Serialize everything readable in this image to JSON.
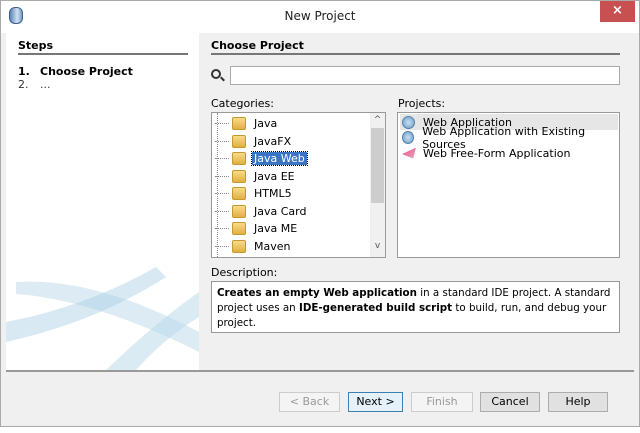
{
  "window": {
    "title": "New Project",
    "close_label": "×"
  },
  "steps": {
    "header": "Steps",
    "items": [
      {
        "num": "1.",
        "label": "Choose Project"
      },
      {
        "num": "2.",
        "label": "..."
      }
    ]
  },
  "main": {
    "header": "Choose Project",
    "search_value": "",
    "categories_label": "Categories:",
    "projects_label": "Projects:",
    "description_label": "Description:"
  },
  "categories": [
    "Java",
    "JavaFX",
    "Java Web",
    "Java EE",
    "HTML5",
    "Java Card",
    "Java ME",
    "Maven"
  ],
  "selected_category": "Java Web",
  "projects": [
    {
      "label": "Web Application",
      "icon": "globe-icon"
    },
    {
      "label": "Web Application with Existing Sources",
      "icon": "globe-icon"
    },
    {
      "label": "Web Free-Form Application",
      "icon": "freeform-icon"
    }
  ],
  "description": {
    "b1": "Creates an empty Web application",
    "t1": " in a standard IDE project. A standard project uses an ",
    "b2": "IDE-generated build script",
    "t2": " to build, run, and debug your project."
  },
  "buttons": {
    "back": "< Back",
    "next": "Next >",
    "finish": "Finish",
    "cancel": "Cancel",
    "help": "Help"
  }
}
